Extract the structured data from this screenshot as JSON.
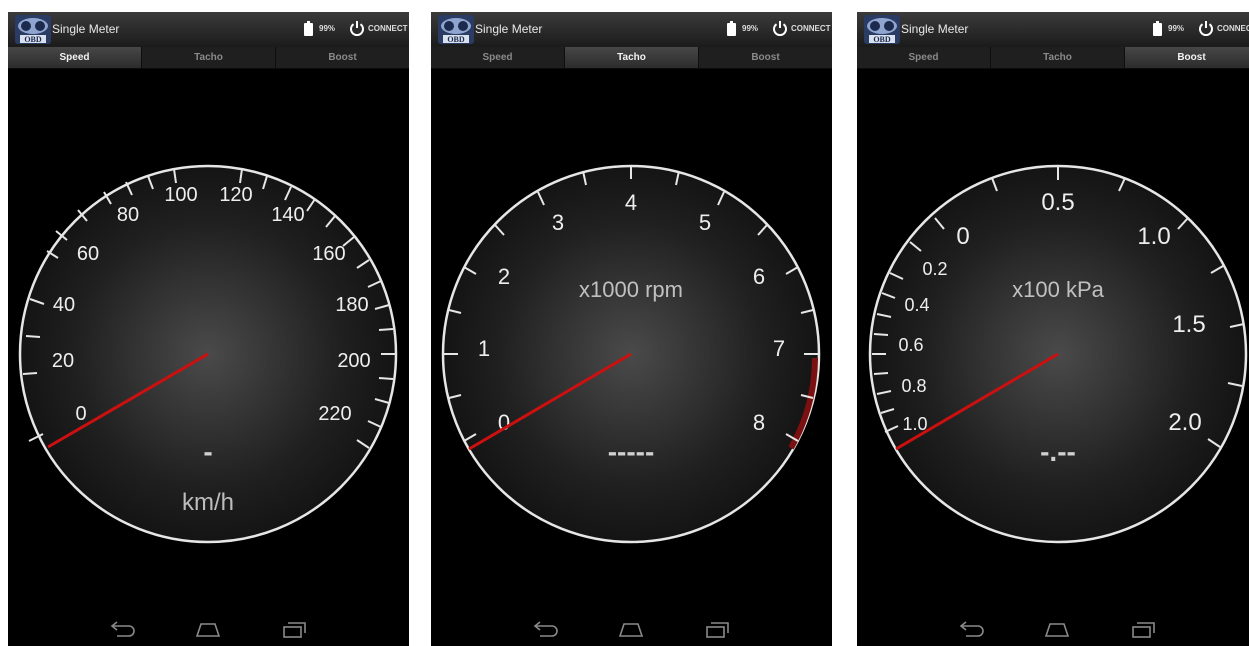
{
  "screens": [
    {
      "app_title": "Single Meter",
      "battery": "99%",
      "connect_label": "CONNECT",
      "tabs": [
        "Speed",
        "Tacho",
        "Boost"
      ],
      "active_tab": 0,
      "gauge": {
        "labels": [
          "0",
          "20",
          "40",
          "60",
          "80",
          "100",
          "120",
          "140",
          "160",
          "180",
          "200",
          "220"
        ],
        "unit": "km/h",
        "readout": "-"
      }
    },
    {
      "app_title": "Single Meter",
      "battery": "99%",
      "connect_label": "CONNECT",
      "tabs": [
        "Speed",
        "Tacho",
        "Boost"
      ],
      "active_tab": 1,
      "gauge": {
        "labels": [
          "0",
          "1",
          "2",
          "3",
          "4",
          "5",
          "6",
          "7",
          "8"
        ],
        "unit": "x1000 rpm",
        "readout": "-----",
        "redzone": "7.8-8"
      }
    },
    {
      "app_title": "Single Meter",
      "battery": "99%",
      "connect_label": "CONNECT",
      "tabs": [
        "Speed",
        "Tacho",
        "Boost"
      ],
      "active_tab": 2,
      "gauge": {
        "labels": [
          "1.0",
          "0.8",
          "0.6",
          "0.4",
          "0.2",
          "0",
          "0.5",
          "1.0",
          "1.5",
          "2.0"
        ],
        "unit": "x100 kPa",
        "readout": "-.--"
      }
    }
  ],
  "nav": {
    "icons": [
      "back-icon",
      "home-icon",
      "recents-icon"
    ]
  },
  "colors": {
    "needle": "#cc1010",
    "redzone": "#7a1010",
    "ring": "#e6e6e6"
  }
}
